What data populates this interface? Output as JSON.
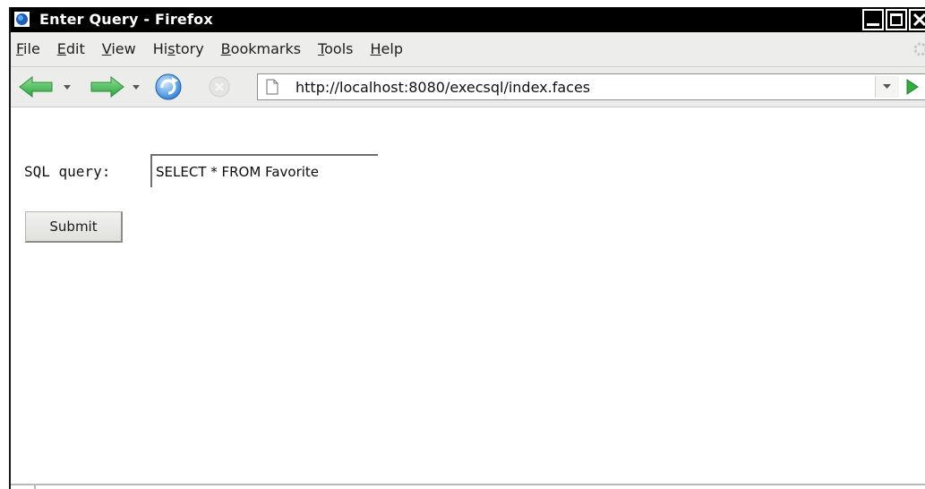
{
  "window": {
    "title": "Enter Query - Firefox"
  },
  "menu": {
    "items": [
      {
        "mnemonic": "F",
        "rest": "ile"
      },
      {
        "mnemonic": "E",
        "rest": "dit",
        "prefix_plain": true
      },
      {
        "mnemonic": "V",
        "rest": "iew"
      },
      {
        "mnemonic": "s",
        "rest": "tory",
        "prefix": "Hi"
      },
      {
        "mnemonic": "B",
        "rest": "ookmarks"
      },
      {
        "mnemonic": "T",
        "rest": "ools"
      },
      {
        "mnemonic": "H",
        "rest": "elp"
      }
    ]
  },
  "navigation": {
    "url": "http://localhost:8080/execsql/index.faces",
    "icons": [
      "back-arrow-icon",
      "forward-arrow-icon",
      "reload-icon",
      "stop-icon",
      "page-icon",
      "go-icon"
    ]
  },
  "form": {
    "label": "SQL query:",
    "query_value": "SELECT * FROM Favorite",
    "submit_label": "Submit"
  },
  "colors": {
    "titlebar": "#000000",
    "chrome": "#ececea",
    "arrow_green": "#33b54a",
    "go_green": "#2fae3c",
    "reload_blue": "#2a7fd6"
  }
}
